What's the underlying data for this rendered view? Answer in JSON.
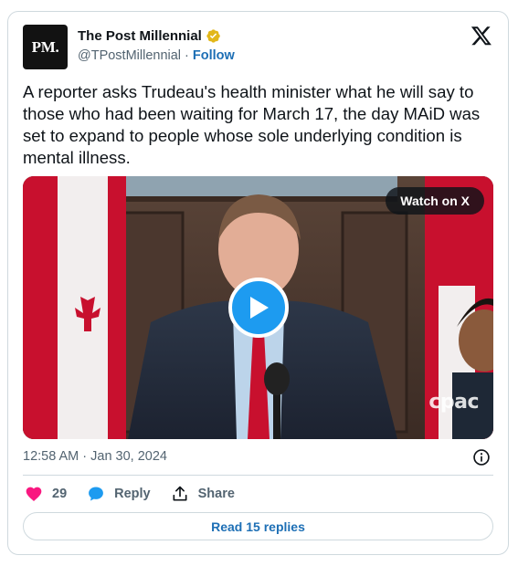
{
  "author": {
    "avatar_text": "PM.",
    "display_name": "The Post Millennial",
    "handle": "@TPostMillennial",
    "separator": "·",
    "follow_label": "Follow"
  },
  "tweet": {
    "text": "A reporter asks Trudeau's health minister what he will say to those who had been waiting for March 17, the day MAiD was set to expand to people whose sole underlying condition is mental illness."
  },
  "media": {
    "watch_label": "Watch on X",
    "watermark": "cpac"
  },
  "meta": {
    "timestamp": "12:58 AM · Jan 30, 2024"
  },
  "actions": {
    "likes_count": "29",
    "reply_label": "Reply",
    "share_label": "Share"
  },
  "footer": {
    "replies_label": "Read 15 replies"
  },
  "icons": {
    "verified": "verified-badge-icon",
    "x_logo": "x-logo-icon",
    "info": "info-icon",
    "heart": "heart-icon",
    "reply": "reply-bubble-icon",
    "share": "share-icon",
    "play": "play-icon"
  },
  "colors": {
    "accent": "#1d9bf0",
    "link": "#1d6fb5",
    "heart": "#f91880",
    "verified_gold": "#e2b719",
    "text_secondary": "#536471"
  }
}
